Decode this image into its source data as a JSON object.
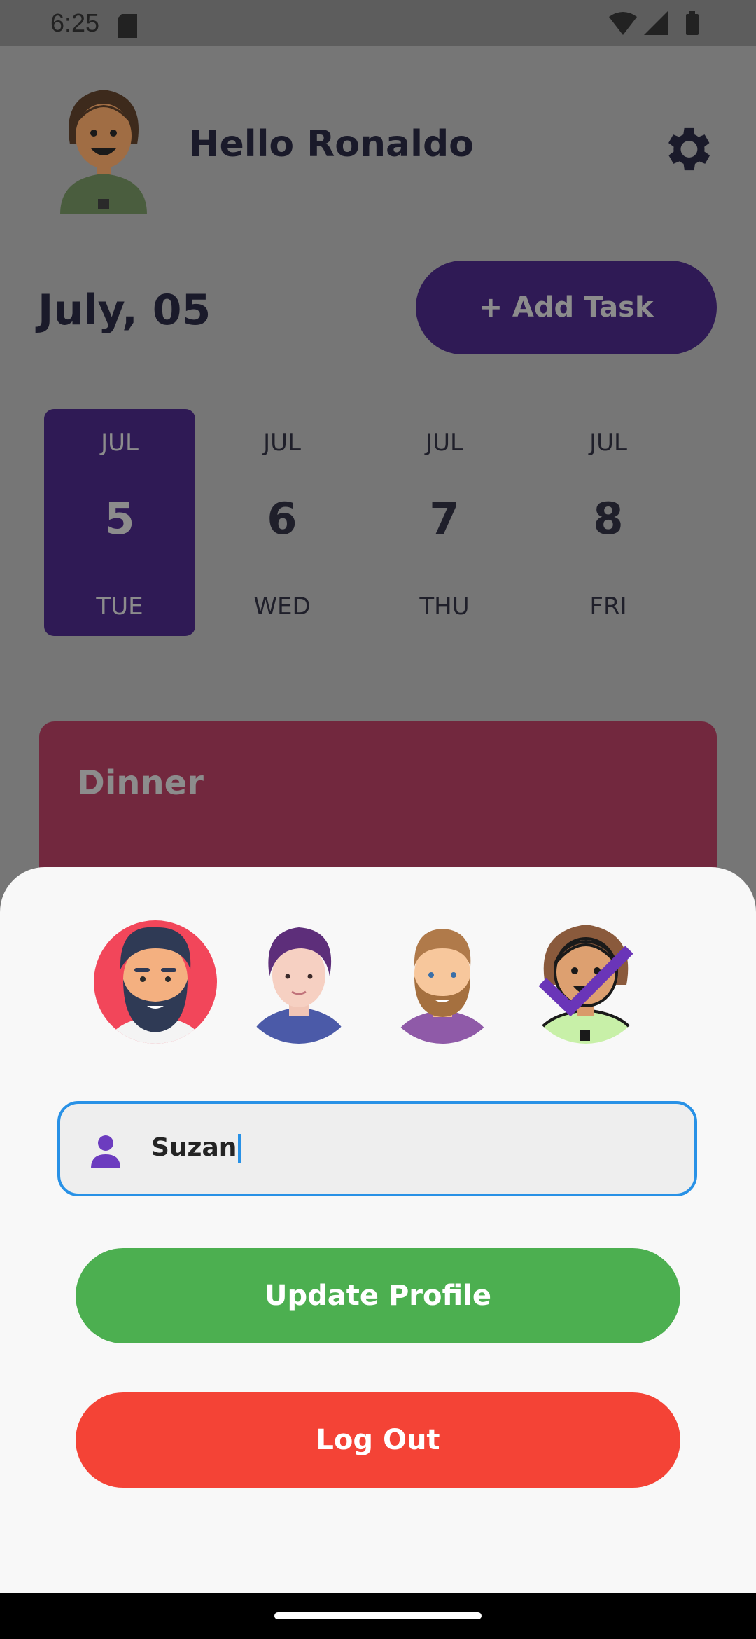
{
  "status_bar": {
    "time": "6:25"
  },
  "header": {
    "greeting": "Hello Ronaldo"
  },
  "date_row": {
    "date": "July, 05",
    "add_task_label": "+ Add Task"
  },
  "days": [
    {
      "month": "JUL",
      "day": "5",
      "weekday": "TUE",
      "selected": true
    },
    {
      "month": "JUL",
      "day": "6",
      "weekday": "WED",
      "selected": false
    },
    {
      "month": "JUL",
      "day": "7",
      "weekday": "THU",
      "selected": false
    },
    {
      "month": "JUL",
      "day": "8",
      "weekday": "FRI",
      "selected": false
    }
  ],
  "task": {
    "title": "Dinner"
  },
  "sheet": {
    "avatars": [
      "bearded-man-avatar",
      "young-man-avatar",
      "ginger-man-avatar",
      "woman-avatar"
    ],
    "selected_avatar": "woman-avatar",
    "name_value": "Suzan",
    "update_label": "Update Profile",
    "logout_label": "Log Out"
  },
  "colors": {
    "accent_purple": "#2f1a55",
    "update_green": "#4caf50",
    "logout_red": "#f44336",
    "focus_blue": "#2891e6",
    "task_card": "#72283e"
  }
}
